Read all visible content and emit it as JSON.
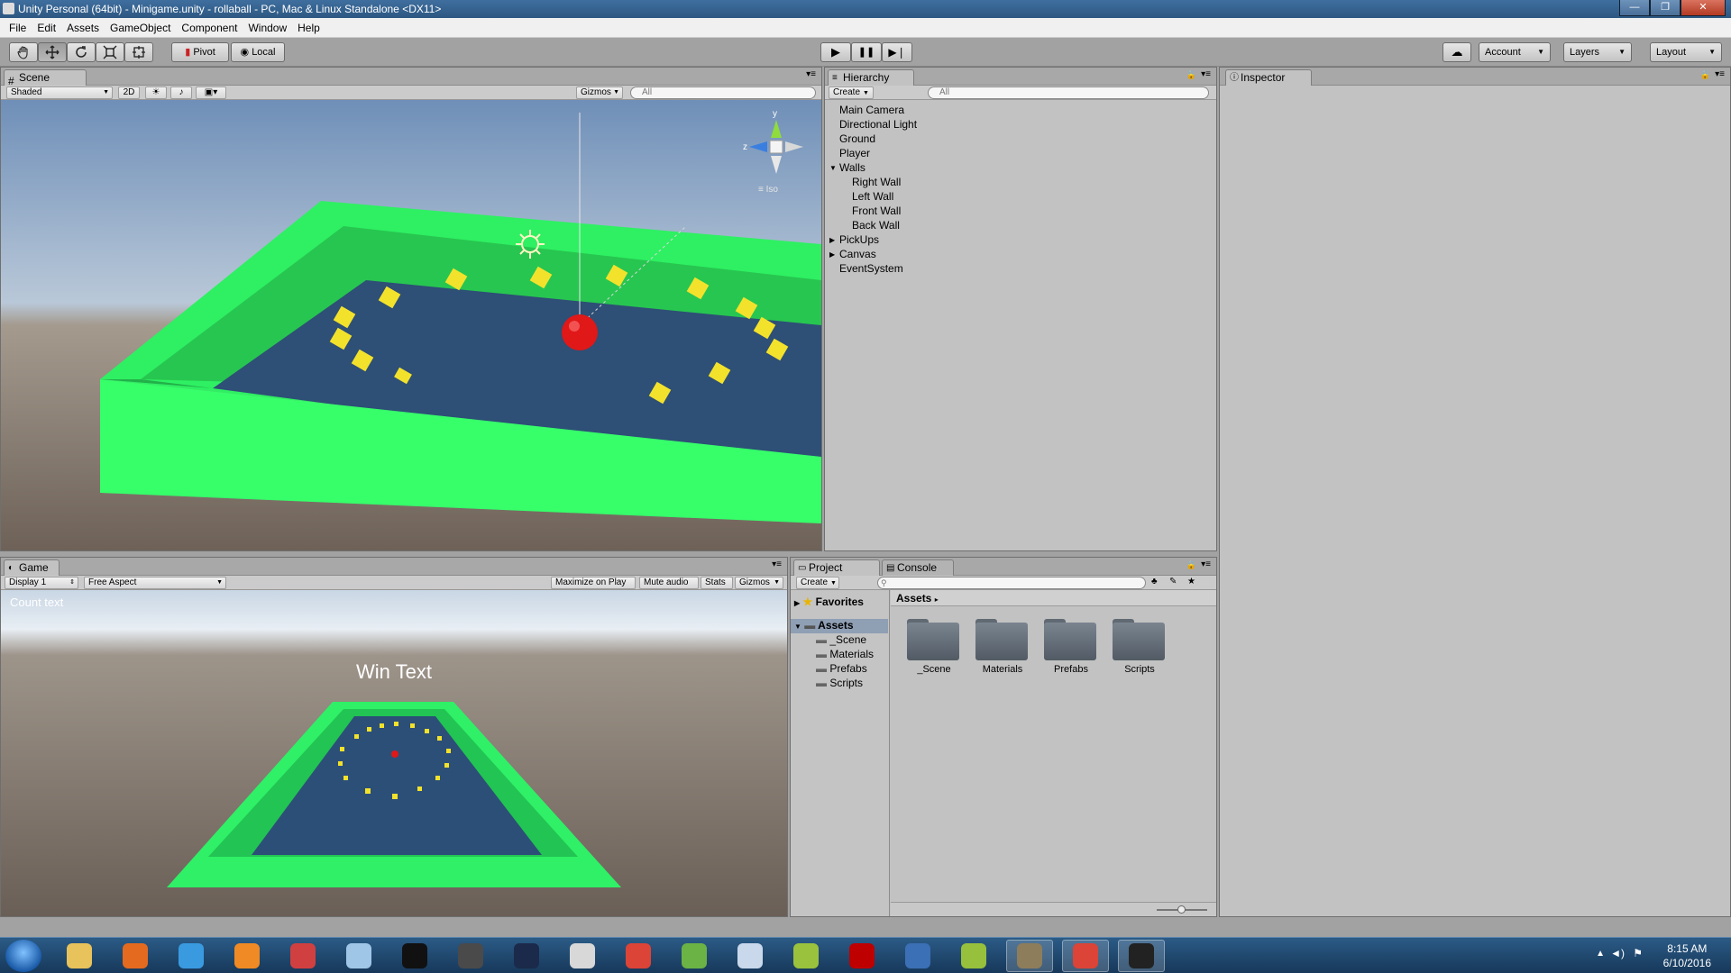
{
  "window": {
    "title": "Unity Personal (64bit) - Minigame.unity - rollaball - PC, Mac & Linux Standalone <DX11>",
    "buttons": [
      "—",
      "❐",
      "✕"
    ]
  },
  "menu": [
    "File",
    "Edit",
    "Assets",
    "GameObject",
    "Component",
    "Window",
    "Help"
  ],
  "toolbar": {
    "transform_tools": [
      "hand-icon",
      "move-icon",
      "rotate-icon",
      "scale-icon",
      "rect-icon"
    ],
    "pivot_label": "Pivot",
    "local_label": "Local",
    "play_symbol": "▶",
    "pause_symbol": "❚❚",
    "step_symbol": "▶❘",
    "cloud_symbol": "☁",
    "account_label": "Account",
    "layers_label": "Layers",
    "layout_label": "Layout"
  },
  "scene": {
    "tab_label": "Scene",
    "shading_mode": "Shaded",
    "mode_2d": "2D",
    "gizmos_label": "Gizmos",
    "search_placeholder": "All",
    "gizmo": {
      "y": "y",
      "z": "z",
      "iso": "≡ Iso"
    }
  },
  "hierarchy": {
    "tab_label": "Hierarchy",
    "create_label": "Create",
    "search_placeholder": "All",
    "items": [
      {
        "label": "Main Camera",
        "indent": 0,
        "arrow": ""
      },
      {
        "label": "Directional Light",
        "indent": 0,
        "arrow": ""
      },
      {
        "label": "Ground",
        "indent": 0,
        "arrow": ""
      },
      {
        "label": "Player",
        "indent": 0,
        "arrow": ""
      },
      {
        "label": "Walls",
        "indent": 0,
        "arrow": "▼"
      },
      {
        "label": "Right Wall",
        "indent": 1,
        "arrow": ""
      },
      {
        "label": "Left Wall",
        "indent": 1,
        "arrow": ""
      },
      {
        "label": "Front Wall",
        "indent": 1,
        "arrow": ""
      },
      {
        "label": "Back Wall",
        "indent": 1,
        "arrow": ""
      },
      {
        "label": "PickUps",
        "indent": 0,
        "arrow": "▶"
      },
      {
        "label": "Canvas",
        "indent": 0,
        "arrow": "▶"
      },
      {
        "label": "EventSystem",
        "indent": 0,
        "arrow": ""
      }
    ]
  },
  "inspector": {
    "tab_label": "Inspector"
  },
  "game": {
    "tab_label": "Game",
    "display_label": "Display 1",
    "aspect_label": "Free Aspect",
    "maximize_label": "Maximize on Play",
    "mute_label": "Mute audio",
    "stats_label": "Stats",
    "gizmos_label": "Gizmos",
    "count_text": "Count text",
    "win_text": "Win Text"
  },
  "project": {
    "tab_label": "Project",
    "console_tab_label": "Console",
    "create_label": "Create",
    "favorites_label": "Favorites",
    "assets_breadcrumb": "Assets",
    "tree_root": "Assets",
    "tree_items": [
      "_Scene",
      "Materials",
      "Prefabs",
      "Scripts"
    ],
    "folders": [
      "_Scene",
      "Materials",
      "Prefabs",
      "Scripts"
    ]
  },
  "taskbar": {
    "time": "8:15 AM",
    "date": "6/10/2016",
    "apps": [
      {
        "name": "explorer-icon",
        "color": "#e8c25a"
      },
      {
        "name": "firefox-icon",
        "color": "#e46a1f"
      },
      {
        "name": "ie-icon",
        "color": "#3a9ae0"
      },
      {
        "name": "blender-icon",
        "color": "#f08a24"
      },
      {
        "name": "apps-grid-icon",
        "color": "#d04040"
      },
      {
        "name": "notes-icon",
        "color": "#9fc6e6"
      },
      {
        "name": "cmd-icon",
        "color": "#111111"
      },
      {
        "name": "sublime-icon",
        "color": "#4a4a4a"
      },
      {
        "name": "photoshop-icon",
        "color": "#1b2a4a"
      },
      {
        "name": "inkscape-icon",
        "color": "#d8d8d8"
      },
      {
        "name": "chrome-icon",
        "color": "#db4437"
      },
      {
        "name": "android-studio-icon",
        "color": "#6ab344"
      },
      {
        "name": "paint-icon",
        "color": "#c9d8ea"
      },
      {
        "name": "notepadpp-icon",
        "color": "#9ac23c"
      },
      {
        "name": "filezilla-icon",
        "color": "#bf0000"
      },
      {
        "name": "network-icon",
        "color": "#3b6fb6"
      },
      {
        "name": "android-icon",
        "color": "#97c03d"
      },
      {
        "name": "gimp-icon",
        "color": "#8e7d5a"
      },
      {
        "name": "chrome-icon-2",
        "color": "#db4437"
      },
      {
        "name": "unity-icon",
        "color": "#222222"
      }
    ]
  }
}
